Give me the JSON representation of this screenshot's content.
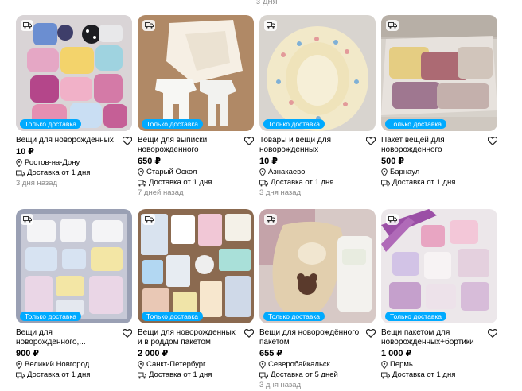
{
  "top_stub": "з дня",
  "badge_label": "Только доставка",
  "listings": [
    {
      "title": "Вещи для новорожденных",
      "price": "10 ₽",
      "city": "Ростов-на-Дону",
      "delivery": "Доставка от 1 дня",
      "date": "3 дня назад"
    },
    {
      "title": "Вещи для выписки новорожденного",
      "price": "650 ₽",
      "city": "Старый Оскол",
      "delivery": "Доставка от 1 дня",
      "date": "7 дней назад"
    },
    {
      "title": "Товары и вещи для новорожденных",
      "price": "10 ₽",
      "city": "Азнакаево",
      "delivery": "Доставка от 1 дня",
      "date": "3 дня назад"
    },
    {
      "title": "Пакет вещей для новорожденного",
      "price": "500 ₽",
      "city": "Барнаул",
      "delivery": "Доставка от 1 дня",
      "date": ""
    },
    {
      "title": "Вещи для новорождённого,...",
      "price": "900 ₽",
      "city": "Великий Новгород",
      "delivery": "Доставка от 1 дня",
      "date": ""
    },
    {
      "title": "Вещи для новорожденных и в роддом пакетом",
      "price": "2 000 ₽",
      "city": "Санкт-Петербург",
      "delivery": "Доставка от 1 дня",
      "date": ""
    },
    {
      "title": "Вещи для новорождённого пакетом",
      "price": "655 ₽",
      "city": "Северобайкальск",
      "delivery": "Доставка от 5 дней",
      "date": "3 дня назад"
    },
    {
      "title": "Вещи пакетом для новорожденных+бортики",
      "price": "1 000 ₽",
      "city": "Пермь",
      "delivery": "Доставка от 1 дня",
      "date": ""
    }
  ],
  "icons": {
    "truck": "truck-icon",
    "heart": "heart-icon",
    "location": "location-pin-icon",
    "delivery": "delivery-box-icon"
  },
  "colors": {
    "badge": "#00aaff",
    "date": "#8a8a8a",
    "text": "#000000"
  }
}
